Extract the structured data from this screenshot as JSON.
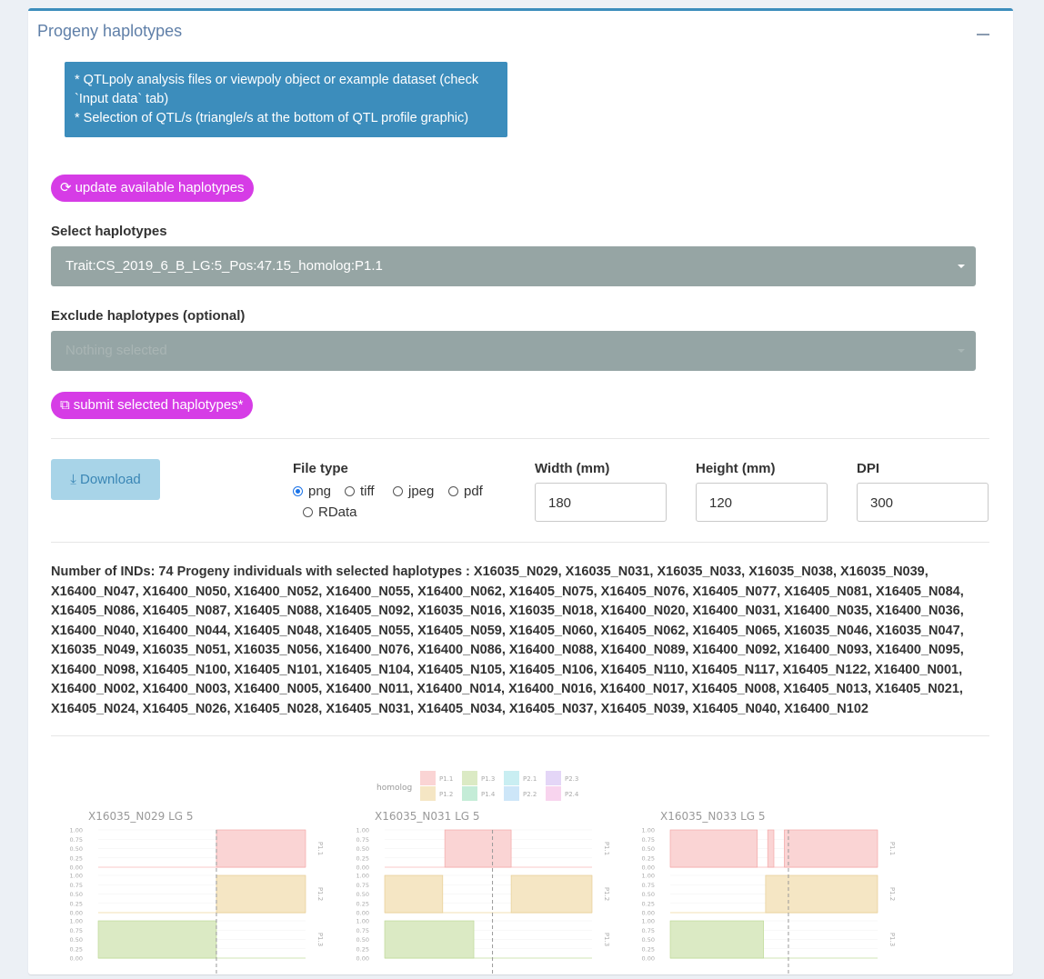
{
  "panel": {
    "title": "Progeny haplotypes"
  },
  "info_lines": [
    "* QTLpoly analysis files or viewpoly object or example dataset (check",
    "`Input data` tab)",
    "* Selection of QTL/s (triangle/s at the bottom of QTL profile graphic)"
  ],
  "update_button": {
    "label": "update available haplotypes",
    "icon": "refresh-icon"
  },
  "select_haplotypes": {
    "label": "Select haplotypes",
    "value": "Trait:CS_2019_6_B_LG:5_Pos:47.15_homolog:P1.1"
  },
  "exclude_haplotypes": {
    "label": "Exclude haplotypes (optional)",
    "placeholder": "Nothing selected"
  },
  "submit_button": {
    "label": "submit selected haplotypes*",
    "icon": "share-icon"
  },
  "download": {
    "button_label": "Download",
    "file_type_label": "File type",
    "options": [
      "png",
      "tiff",
      "jpeg",
      "pdf",
      "RData"
    ],
    "selected": "png",
    "width_label": "Width (mm)",
    "width_value": "180",
    "height_label": "Height (mm)",
    "height_value": "120",
    "dpi_label": "DPI",
    "dpi_value": "300"
  },
  "individuals_text": "Number of INDs: 74 Progeny individuals with selected haplotypes : X16035_N029, X16035_N031, X16035_N033, X16035_N038, X16035_N039, X16400_N047, X16400_N050, X16400_N052, X16400_N055, X16400_N062, X16405_N075, X16405_N076, X16405_N077, X16405_N081, X16405_N084, X16405_N086, X16405_N087, X16405_N088, X16405_N092, X16035_N016, X16035_N018, X16400_N020, X16400_N031, X16400_N035, X16400_N036, X16400_N040, X16400_N044, X16405_N048, X16405_N055, X16405_N059, X16405_N060, X16405_N062, X16405_N065, X16035_N046, X16035_N047, X16035_N049, X16035_N051, X16035_N056, X16400_N076, X16400_N086, X16400_N088, X16400_N089, X16400_N092, X16400_N093, X16400_N095, X16400_N098, X16405_N100, X16405_N101, X16405_N104, X16405_N105, X16405_N106, X16405_N110, X16405_N117, X16405_N122, X16400_N001, X16400_N002, X16400_N003, X16400_N005, X16400_N011, X16400_N014, X16400_N016, X16400_N017, X16405_N008, X16405_N013, X16405_N021, X16405_N024, X16405_N026, X16405_N028, X16405_N031, X16405_N034, X16405_N037, X16405_N039, X16405_N040, X16400_N102",
  "chart_data": {
    "type": "area",
    "legend": {
      "title": "homolog",
      "entries": [
        "P1.1",
        "P1.2",
        "P1.3",
        "P1.4",
        "P2.1",
        "P2.2",
        "P2.3",
        "P2.4"
      ],
      "colors": [
        "#fad4d4",
        "#f5e6c4",
        "#dbeac4",
        "#c4ecd7",
        "#c9eef2",
        "#cde6f8",
        "#e4d6f7",
        "#f8d4ee"
      ],
      "placement": "top"
    },
    "y_ticks": [
      "1.00",
      "0.75",
      "0.50",
      "0.25",
      "0.00"
    ],
    "ylim": [
      0,
      1
    ],
    "panels": [
      {
        "title": "X16035_N029",
        "lg": "LG 5",
        "rows": [
          {
            "homolog": "P1.1",
            "segments": [
              [
                0.57,
                1.0
              ]
            ]
          },
          {
            "homolog": "P1.2",
            "segments": [
              [
                0.57,
                1.0
              ]
            ]
          },
          {
            "homolog": "P1.3",
            "segments": [
              [
                0.0,
                0.57
              ]
            ]
          }
        ]
      },
      {
        "title": "X16035_N031",
        "lg": "LG 5",
        "rows": [
          {
            "homolog": "P1.1",
            "segments": [
              [
                0.29,
                0.61
              ]
            ]
          },
          {
            "homolog": "P1.2",
            "segments": [
              [
                0.0,
                0.28
              ],
              [
                0.61,
                1.0
              ]
            ]
          },
          {
            "homolog": "P1.3",
            "segments": [
              [
                0.0,
                0.43
              ]
            ]
          }
        ]
      },
      {
        "title": "X16035_N033",
        "lg": "LG 5",
        "rows": [
          {
            "homolog": "P1.1",
            "segments": [
              [
                0.0,
                0.42
              ],
              [
                0.47,
                0.5
              ],
              [
                0.55,
                1.0
              ]
            ]
          },
          {
            "homolog": "P1.2",
            "segments": [
              [
                0.46,
                1.0
              ]
            ]
          },
          {
            "homolog": "P1.3",
            "segments": [
              [
                0.0,
                0.45
              ]
            ]
          }
        ]
      }
    ]
  }
}
